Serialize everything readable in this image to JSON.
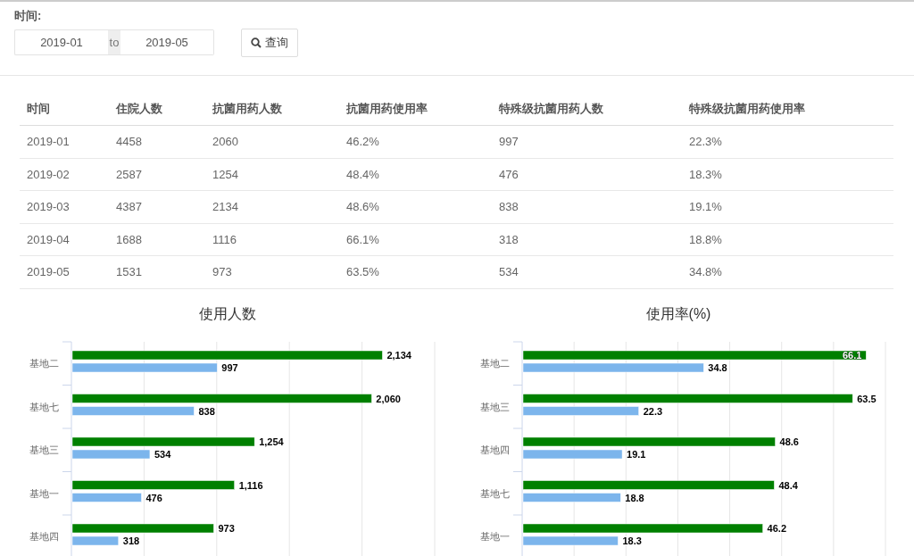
{
  "filter": {
    "label": "时间:",
    "from": "2019-01",
    "separator": "to",
    "to": "2019-05",
    "search_button": "查询"
  },
  "table": {
    "columns": [
      "时间",
      "住院人数",
      "抗菌用药人数",
      "抗菌用药使用率",
      "特殊级抗菌用药人数",
      "特殊级抗菌用药使用率"
    ],
    "rows": [
      [
        "2019-01",
        "4458",
        "2060",
        "46.2%",
        "997",
        "22.3%"
      ],
      [
        "2019-02",
        "2587",
        "1254",
        "48.4%",
        "476",
        "18.3%"
      ],
      [
        "2019-03",
        "4387",
        "2134",
        "48.6%",
        "838",
        "19.1%"
      ],
      [
        "2019-04",
        "1688",
        "1116",
        "66.1%",
        "318",
        "18.8%"
      ],
      [
        "2019-05",
        "1531",
        "973",
        "63.5%",
        "534",
        "34.8%"
      ]
    ]
  },
  "charts": [
    {
      "chart_data": {
        "type": "bar",
        "title": "使用人数",
        "orientation": "horizontal",
        "categories": [
          "基地二",
          "基地七",
          "基地三",
          "基地一",
          "基地四"
        ],
        "xlim": [
          0,
          2500
        ],
        "data_labels": true,
        "series": [
          {
            "color": "#008000",
            "values": [
              2134,
              2060,
              1254,
              1116,
              973
            ],
            "value_labels": [
              "2,134",
              "2,060",
              "1,254",
              "1,116",
              "973"
            ]
          },
          {
            "color": "#7cb5ec",
            "values": [
              997,
              838,
              534,
              476,
              318
            ],
            "value_labels": [
              "997",
              "838",
              "534",
              "476",
              "318"
            ]
          }
        ]
      }
    },
    {
      "chart_data": {
        "type": "bar",
        "title": "使用率(%)",
        "orientation": "horizontal",
        "categories": [
          "基地二",
          "基地三",
          "基地四",
          "基地七",
          "基地一"
        ],
        "xlim": [
          0,
          70
        ],
        "data_labels": true,
        "series": [
          {
            "color": "#008000",
            "values": [
              66.1,
              63.5,
              48.6,
              48.4,
              46.2
            ]
          },
          {
            "color": "#7cb5ec",
            "values": [
              34.8,
              22.3,
              19.1,
              18.8,
              18.3
            ]
          }
        ]
      }
    }
  ]
}
